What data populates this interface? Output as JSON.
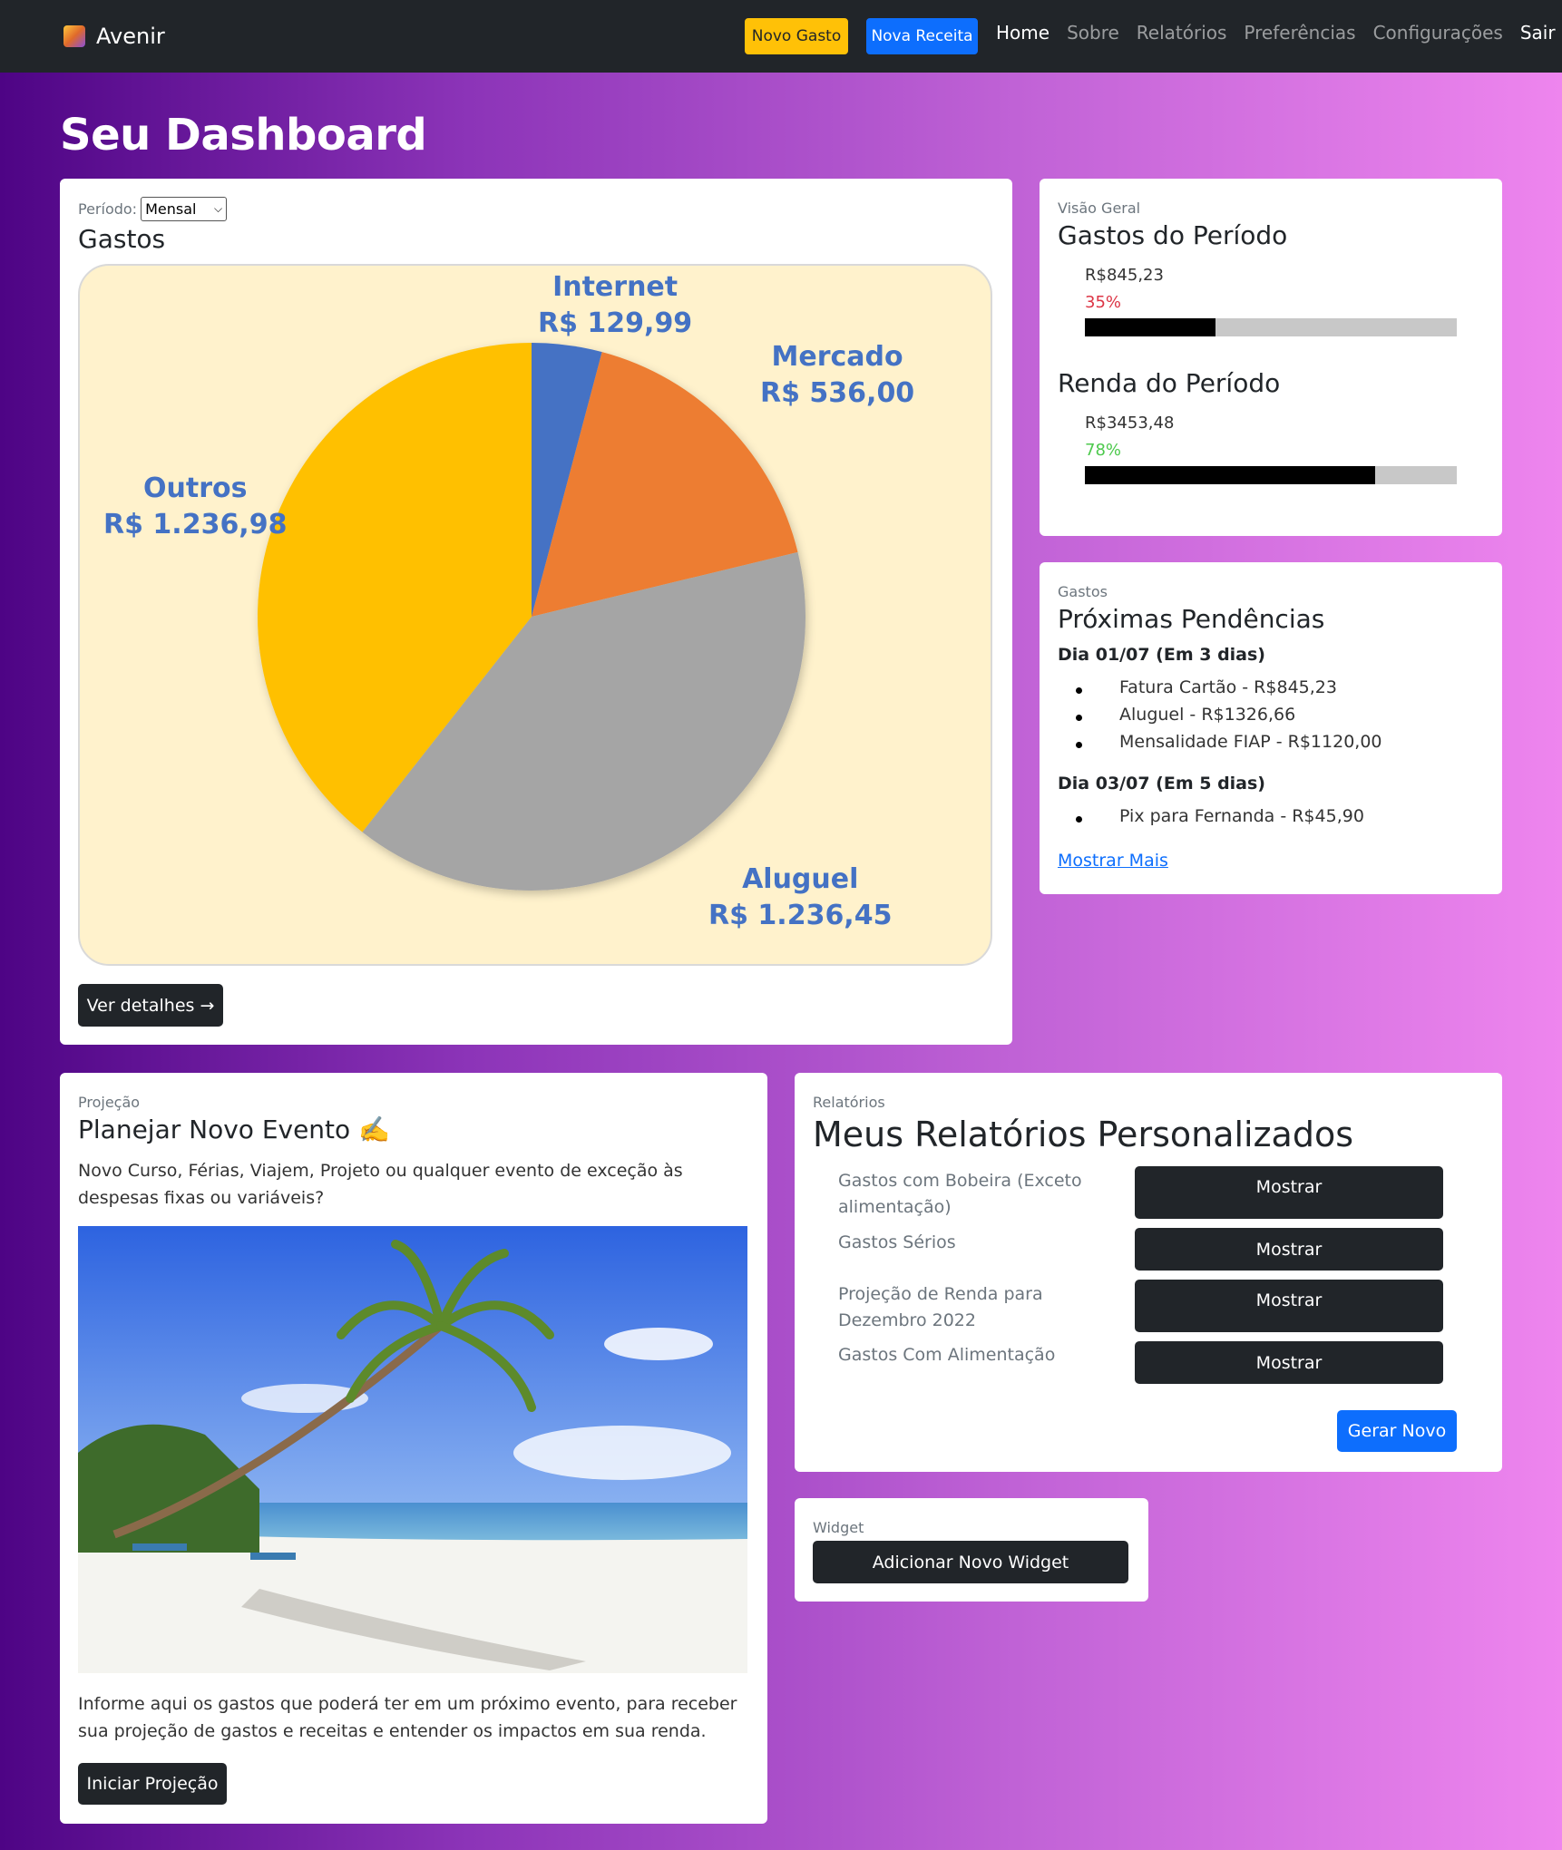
{
  "navbar": {
    "brand": "Avenir",
    "novo_gasto": "Novo Gasto",
    "nova_receita": "Nova Receita",
    "links": [
      "Home",
      "Sobre",
      "Relatórios",
      "Preferências",
      "Configurações",
      "Sair"
    ]
  },
  "page_title": "Seu Dashboard",
  "gastos_card": {
    "period_label": "Período:",
    "period_value": "Mensal",
    "title": "Gastos",
    "button": "Ver detalhes →",
    "chart_data": {
      "type": "pie",
      "categories": [
        "Internet",
        "Mercado",
        "Aluguel",
        "Outros"
      ],
      "value_labels": [
        "R$ 129,99",
        "R$ 536,00",
        "R$ 1.236,45",
        "R$ 1.236,98"
      ],
      "values": [
        129.99,
        536.0,
        1236.45,
        1236.98
      ],
      "colors": [
        "#4472c4",
        "#ed7d31",
        "#a5a5a5",
        "#ffc000"
      ]
    }
  },
  "overview": {
    "subtitle": "Visão Geral",
    "gastos_title": "Gastos do Período",
    "gastos_value": "R$845,23",
    "gastos_pct": "35%",
    "gastos_fraction": 0.35,
    "renda_title": "Renda do Período",
    "renda_value": "R$3453,48",
    "renda_pct": "78%",
    "renda_fraction": 0.78
  },
  "pendencias": {
    "subtitle": "Gastos",
    "title": "Próximas Pendências",
    "groups": [
      {
        "date": "Dia 01/07 (Em 3 dias)",
        "items": [
          "Fatura Cartão - R$845,23",
          "Aluguel - R$1326,66",
          "Mensalidade FIAP - R$1120,00"
        ]
      },
      {
        "date": "Dia 03/07 (Em 5 dias)",
        "items": [
          "Pix para Fernanda - R$45,90"
        ]
      }
    ],
    "more": "Mostrar Mais"
  },
  "projecao": {
    "subtitle": "Projeção",
    "title": "Planejar Novo Evento ✍️",
    "description": "Novo Curso, Férias, Viajem, Projeto ou qualquer evento de exceção às despesas fixas ou variáveis?",
    "text": "Informe aqui os gastos que poderá ter em um próximo evento, para receber sua projeção de gastos e receitas e entender os impactos em sua renda.",
    "button": "Iniciar Projeção"
  },
  "relatorios": {
    "subtitle": "Relatórios",
    "title": "Meus Relatórios Personalizados",
    "reports": [
      "Gastos com Bobeira (Exceto alimentação)",
      "Gastos Sérios",
      "Projeção de Renda para Dezembro 2022",
      "Gastos Com Alimentação"
    ],
    "show_label": "Mostrar",
    "generate": "Gerar Novo"
  },
  "widget": {
    "subtitle": "Widget",
    "button": "Adicionar Novo Widget"
  }
}
